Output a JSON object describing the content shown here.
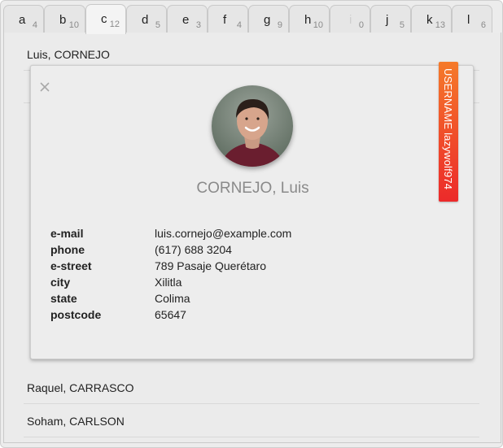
{
  "tabs": [
    {
      "letter": "a",
      "count": "4"
    },
    {
      "letter": "b",
      "count": "10"
    },
    {
      "letter": "c",
      "count": "12",
      "active": true
    },
    {
      "letter": "d",
      "count": "5"
    },
    {
      "letter": "e",
      "count": "3"
    },
    {
      "letter": "f",
      "count": "4"
    },
    {
      "letter": "g",
      "count": "9"
    },
    {
      "letter": "h",
      "count": "10"
    },
    {
      "letter": "i",
      "count": "0",
      "disabled": true
    },
    {
      "letter": "j",
      "count": "5"
    },
    {
      "letter": "k",
      "count": "13"
    },
    {
      "letter": "l",
      "count": "6"
    }
  ],
  "list": {
    "top_item": "Luis, CORNEJO",
    "items_below": [
      "Raquel, CARRASCO",
      "Soham, CARLSON"
    ]
  },
  "card": {
    "full_name": "CORNEJO, Luis",
    "close_icon": "close-icon",
    "details": [
      {
        "label": "e-mail",
        "value": "luis.cornejo@example.com"
      },
      {
        "label": "phone",
        "value": "(617) 688 3204"
      },
      {
        "label": "e-street",
        "value": "789 Pasaje Querétaro"
      },
      {
        "label": "city",
        "value": "Xilitla"
      },
      {
        "label": "state",
        "value": "Colima"
      },
      {
        "label": "postcode",
        "value": "65647"
      }
    ]
  },
  "ribbon": {
    "text": "USERNAME lazywolf974",
    "colors": [
      "#f57a2a",
      "#ec2a2a"
    ]
  }
}
